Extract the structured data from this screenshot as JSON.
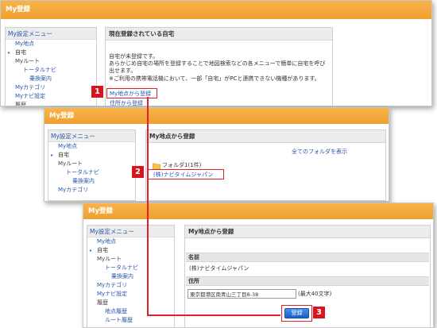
{
  "shot1": {
    "title": "My登録",
    "sidebar": {
      "head": "My設定メニュー",
      "items": [
        "My地点",
        "自宅",
        "Myルート",
        "トータルナビ",
        "乗換案内",
        "Myカテゴリ",
        "Myナビ設定",
        "履歴"
      ]
    },
    "panel": {
      "head": "現在登録されている自宅",
      "line1": "自宅が未登録です。",
      "line2": "あらかじめ自宅の場所を登録することで地図検索などの各メニューで簡単に自宅を呼び",
      "line3": "出せます。",
      "line4": "※ご利用の携帯電話機において、一部「自宅」がPCと連携できない機種があります。",
      "link1": "My地点から登録",
      "link2": "住所から登録"
    }
  },
  "shot2": {
    "title": "My登録",
    "sidebar": {
      "head": "My設定メニュー",
      "items": [
        "My地点",
        "自宅",
        "Myルート",
        "トータルナビ",
        "乗換案内",
        "Myカテゴリ"
      ]
    },
    "panel": {
      "head": "My地点から登録",
      "show_all": "全てのフォルダを表示",
      "folder": "フォルダ1(1件)",
      "entry": "(株)ナビタイムジャパン"
    }
  },
  "shot3": {
    "title": "My登録",
    "sidebar": {
      "head": "My設定メニュー",
      "items": [
        "My地点",
        "自宅",
        "Myルート",
        "トータルナビ",
        "乗換案内",
        "Myカテゴリ",
        "Myナビ設定",
        "履歴",
        "地点履歴",
        "ルート履歴"
      ]
    },
    "panel": {
      "head": "My地点から登録",
      "name_label": "名前",
      "name_value": "(株)ナビタイムジャパン",
      "addr_label": "住所",
      "addr_value": "東京都港区南青山三丁目8-38",
      "addr_note": "(最大40文字)",
      "register_button": "登録"
    }
  },
  "badges": [
    "1",
    "2",
    "3"
  ],
  "colors": {
    "accent": "#f0a030",
    "highlight": "#e0202a",
    "link": "#2a55aa"
  }
}
